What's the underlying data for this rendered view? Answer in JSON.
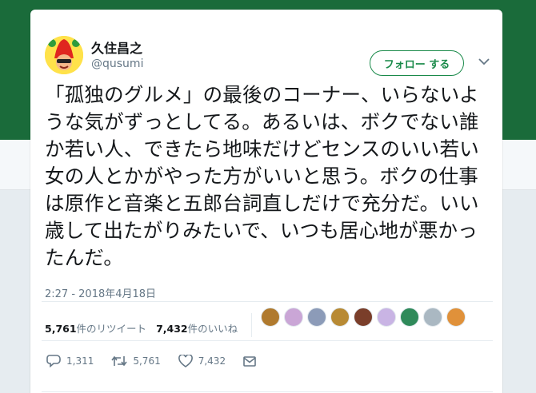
{
  "user": {
    "display_name": "久住昌之",
    "handle": "@qusumi",
    "avatar": "red-beanie-character-avatar"
  },
  "follow_button": {
    "label": "フォロー する"
  },
  "menu": {
    "icon": "chevron-down-icon"
  },
  "tweet": {
    "text": "「孤独のグルメ」の最後のコーナー、いらないような気がずっとしてる。あるいは、ボクでない誰か若い人、できたら地味だけどセンスのいい若い女の人とかがやった方がいいと思う。ボクの仕事は原作と音楽と五郎台詞直しだけで充分だ。いい歳して出たがりみたいで、いつも居心地が悪かったんだ。",
    "timestamp": "2:27 - 2018年4月18日"
  },
  "stats": {
    "retweets_count": "5,761",
    "retweets_label": "件のリツイート",
    "likes_count": "7,432",
    "likes_label": "件のいいね"
  },
  "likers": [
    {
      "icon": "liker-avatar-1",
      "color": "#b07a2e"
    },
    {
      "icon": "liker-avatar-2",
      "color": "#caa6d6"
    },
    {
      "icon": "liker-avatar-3",
      "color": "#8c9bb8"
    },
    {
      "icon": "liker-avatar-4",
      "color": "#b88a34"
    },
    {
      "icon": "liker-avatar-5",
      "color": "#7a3e2a"
    },
    {
      "icon": "liker-avatar-6",
      "color": "#c9b4e4"
    },
    {
      "icon": "liker-avatar-7",
      "color": "#2f8a5a"
    },
    {
      "icon": "liker-avatar-default",
      "color": "#aab8c2"
    },
    {
      "icon": "liker-avatar-9",
      "color": "#e0913a"
    }
  ],
  "actions": {
    "reply_count": "1,311",
    "retweet_count": "5,761",
    "like_count": "7,432"
  },
  "colors": {
    "brand": "#1a8a4a",
    "header_bg": "#1a6b3a",
    "text": "#14171a",
    "muted": "#657786"
  }
}
